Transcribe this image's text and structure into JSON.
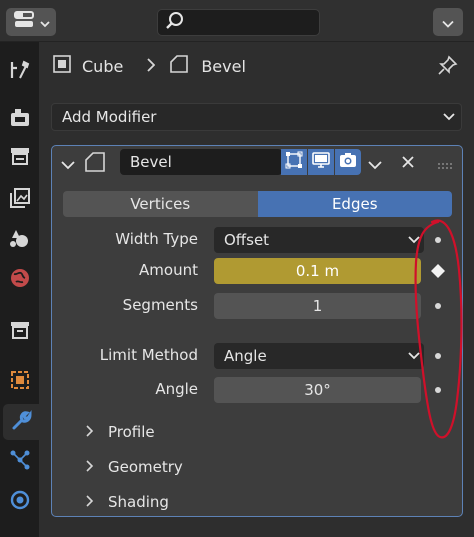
{
  "header": {
    "search_placeholder": "",
    "editor_type_icon": "properties-editor-icon",
    "options_icon": "chevron-down-icon"
  },
  "breadcrumb": {
    "object": "Cube",
    "modifier": "Bevel"
  },
  "add_modifier": {
    "label": "Add Modifier"
  },
  "modifier": {
    "name": "Bevel",
    "affect_tabs": [
      {
        "label": "Vertices",
        "active": false
      },
      {
        "label": "Edges",
        "active": true
      }
    ],
    "width_type": {
      "label": "Width Type",
      "value": "Offset"
    },
    "amount": {
      "label": "Amount",
      "value": "0.1 m",
      "keyframed": true
    },
    "segments": {
      "label": "Segments",
      "value": "1"
    },
    "limit_method": {
      "label": "Limit Method",
      "value": "Angle"
    },
    "angle": {
      "label": "Angle",
      "value": "30°"
    },
    "subpanels": [
      "Profile",
      "Geometry",
      "Shading"
    ]
  },
  "colors": {
    "accent": "#4772b3",
    "animated_field": "#b09a32",
    "annotation": "#d0102a"
  }
}
